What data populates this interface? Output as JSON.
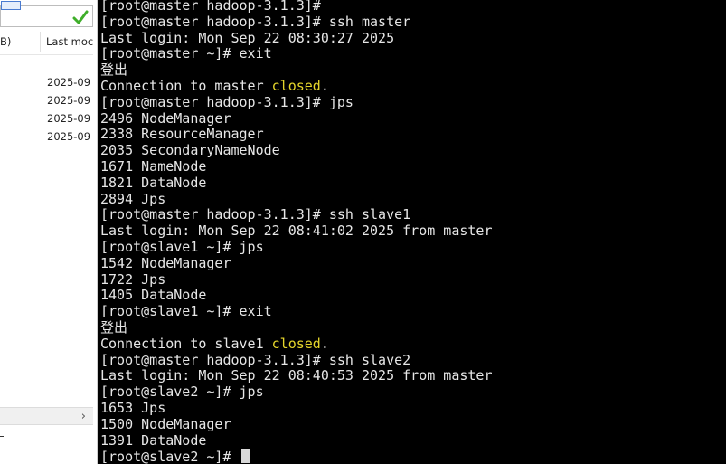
{
  "file_browser": {
    "header": {
      "size_label": "B)",
      "modified_label": "Last moc"
    },
    "rows": [
      "2025-09",
      "2025-09",
      "2025-09",
      "2025-09"
    ],
    "scroll_arrow": "›"
  },
  "terminal": {
    "lines": [
      "[root@master hadoop-3.1.3]#",
      "[root@master hadoop-3.1.3]# ssh master",
      "Last login: Mon Sep 22 08:30:27 2025",
      "[root@master ~]# exit",
      "登出",
      "Connection to master |closed|.",
      "[root@master hadoop-3.1.3]# jps",
      "2496 NodeManager",
      "2338 ResourceManager",
      "2035 SecondaryNameNode",
      "1671 NameNode",
      "1821 DataNode",
      "2894 Jps",
      "[root@master hadoop-3.1.3]# ssh slave1",
      "Last login: Mon Sep 22 08:41:02 2025 from master",
      "[root@slave1 ~]# jps",
      "1542 NodeManager",
      "1722 Jps",
      "1405 DataNode",
      "[root@slave1 ~]# exit",
      "登出",
      "Connection to slave1 |closed|.",
      "[root@master hadoop-3.1.3]# ssh slave2",
      "Last login: Mon Sep 22 08:40:53 2025 from master",
      "[root@slave2 ~]# jps",
      "1653 Jps",
      "1500 NodeManager",
      "1391 DataNode",
      "[root@slave2 ~]#"
    ],
    "colors": {
      "background": "#000000",
      "text": "#e6e6e6",
      "highlight": "#e5d52b"
    }
  }
}
